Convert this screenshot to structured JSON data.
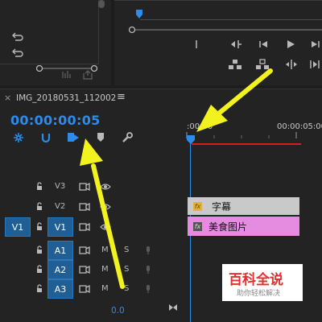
{
  "sequence": {
    "name": "IMG_20180531_112002",
    "close": "×",
    "menu": "≡",
    "timecode": "00:00:00:05"
  },
  "ruler": {
    "start": ":00:00",
    "end": "00:00:05:00"
  },
  "tracks": {
    "video": [
      {
        "name": "V3",
        "src": ""
      },
      {
        "name": "V2",
        "src": ""
      },
      {
        "name": "V1",
        "src": "V1"
      }
    ],
    "audio": [
      {
        "name": "A1",
        "m": "M",
        "s": "S"
      },
      {
        "name": "A2",
        "m": "M",
        "s": "S"
      },
      {
        "name": "A3",
        "m": "M",
        "s": "S"
      }
    ]
  },
  "master": {
    "value": "0.0"
  },
  "clips": {
    "subtitle": {
      "fx": "fx",
      "label": "字幕"
    },
    "video": {
      "fx": "fx",
      "label": "美食图片"
    }
  },
  "watermark": {
    "title": "百科全说",
    "subtitle": "助你轻松解决"
  },
  "colors": {
    "accent": "#2d8ceb",
    "clip_subtitle": "#c9c9c9",
    "clip_video": "#e58be0",
    "arrow": "#f2f21e"
  }
}
